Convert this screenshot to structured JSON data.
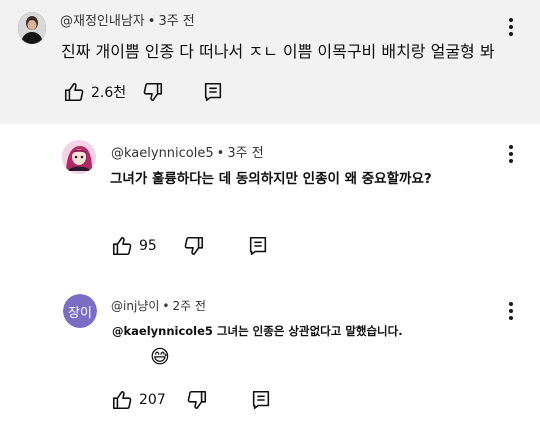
{
  "comments": [
    {
      "author": "@재정인내남자",
      "time": "3주 전",
      "text": "진짜 개이쁨 인종 다 떠나서 ㅈㄴ 이쁨 이목구비 배치랑 얼굴형 봐",
      "likes": "2.6천",
      "avatar_icon": "person-photo-avatar"
    },
    {
      "author": "@kaelynnicole5",
      "time": "3주 전",
      "text": "그녀가 훌륭하다는 데 동의하지만 인종이 왜 중요할까요?",
      "likes": "95",
      "avatar_icon": "anime-avatar"
    },
    {
      "author": "@inj냥이",
      "time": "2주 전",
      "text": "@kaelynnicole5 그녀는 인종은 상관없다고 말했습니다.",
      "emoji": "😅",
      "likes": "207",
      "avatar_label": "장이",
      "avatar_color": "#7b6cc4"
    }
  ],
  "separator": "•",
  "icons": {
    "like": "thumbs-up-icon",
    "dislike": "thumbs-down-icon",
    "reply": "reply-comment-icon",
    "more": "more-vertical-icon"
  }
}
